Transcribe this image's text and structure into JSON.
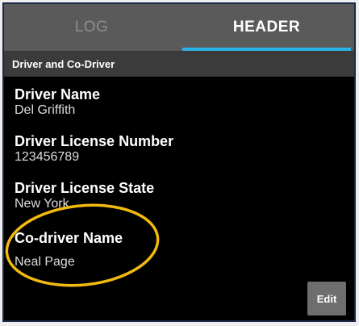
{
  "tabs": [
    {
      "label": "LOG",
      "active": false
    },
    {
      "label": "HEADER",
      "active": true
    }
  ],
  "section": {
    "title": "Driver and Co-Driver"
  },
  "fields": {
    "driver_name": {
      "label": "Driver Name",
      "value": "Del Griffith"
    },
    "license_number": {
      "label": "Driver License Number",
      "value": "123456789"
    },
    "license_state": {
      "label": "Driver License State",
      "value": "New York"
    },
    "codriver_name": {
      "label": "Co-driver Name",
      "value": "Neal Page"
    }
  },
  "buttons": {
    "edit_label": "Edit"
  },
  "colors": {
    "active_tab_underline": "#2bb3e6",
    "annotation_ellipse": "#f2b90f",
    "background": "#000000",
    "tabbar": "#5a5a5a"
  }
}
